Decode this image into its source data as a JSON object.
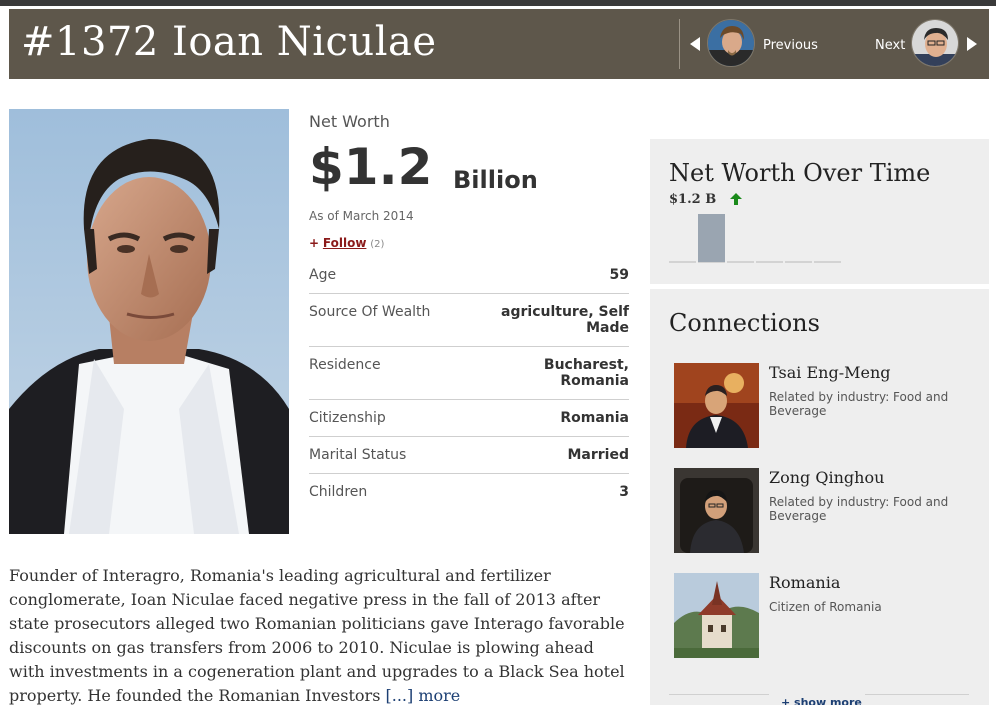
{
  "header": {
    "title": "#1372 Ioan Niculae",
    "prev_label": "Previous",
    "next_label": "Next"
  },
  "profile": {
    "net_worth_label": "Net Worth",
    "net_worth_amount": "$1.2",
    "net_worth_unit": "Billion",
    "as_of": "As of March 2014",
    "follow_plus": "+",
    "follow_label": "Follow",
    "follow_count": "(2)",
    "facts": [
      {
        "label": "Age",
        "value": "59"
      },
      {
        "label": "Source Of Wealth",
        "value": "agriculture, Self Made"
      },
      {
        "label": "Residence",
        "value": "Bucharest, Romania"
      },
      {
        "label": "Citizenship",
        "value": "Romania"
      },
      {
        "label": "Marital Status",
        "value": "Married"
      },
      {
        "label": "Children",
        "value": "3"
      }
    ]
  },
  "bio": {
    "text": "Founder of Interagro, Romania's leading agricultural and fertilizer conglomerate, Ioan Niculae faced negative press in the fall of 2013 after state prosecutors alleged two Romanian politicians gave Interago favorable discounts on gas transfers from 2006 to 2010. Niculae is plowing ahead with investments in a cogeneration plant and upgrades to a Black Sea hotel property. He founded the Romanian Investors ",
    "more_label": "[...] more"
  },
  "net_worth_panel": {
    "title": "Net Worth Over Time",
    "current": "$1.2 B",
    "trend": "up",
    "up_color": "#1a8a1a"
  },
  "chart_data": {
    "type": "bar",
    "categories": [
      "",
      "",
      "",
      "",
      "",
      ""
    ],
    "values": [
      0,
      1.2,
      0,
      0,
      0,
      0
    ],
    "ylim": [
      0,
      1.2
    ],
    "bar_color": "#9aa5b1",
    "grid": false
  },
  "connections": {
    "title": "Connections",
    "items": [
      {
        "name": "Tsai Eng-Meng",
        "desc": "Related by industry: Food and Beverage"
      },
      {
        "name": "Zong Qinghou",
        "desc": "Related by industry: Food and Beverage"
      },
      {
        "name": "Romania",
        "desc": "Citizen of Romania"
      }
    ],
    "show_more": "+ show more"
  }
}
